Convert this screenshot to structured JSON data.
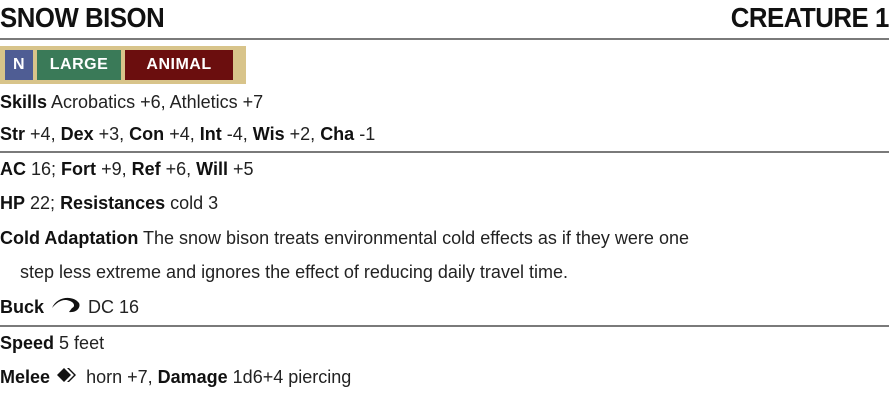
{
  "creature": {
    "name": "SNOW BISON",
    "level": "CREATURE 1"
  },
  "traits": [
    {
      "label": "N",
      "color": "#4f5d94"
    },
    {
      "label": "LARGE",
      "color": "#3a7a58"
    },
    {
      "label": "ANIMAL",
      "color": "#6b0e0e"
    }
  ],
  "skills": {
    "label": "Skills",
    "text": "Acrobatics +6, Athletics +7"
  },
  "abilities": [
    {
      "label": "Str",
      "value": "+4",
      "sep": ", "
    },
    {
      "label": "Dex",
      "value": "+3",
      "sep": ", "
    },
    {
      "label": "Con",
      "value": "+4",
      "sep": ", "
    },
    {
      "label": "Int",
      "value": "-4",
      "sep": ", "
    },
    {
      "label": "Wis",
      "value": "+2",
      "sep": ", "
    },
    {
      "label": "Cha",
      "value": "-1",
      "sep": ""
    }
  ],
  "defense": {
    "ac_label": "AC",
    "ac_value": "16; ",
    "fort_label": "Fort",
    "fort_value": "+9, ",
    "ref_label": "Ref",
    "ref_value": "+6, ",
    "will_label": "Will",
    "will_value": "+5"
  },
  "hp": {
    "label": "HP",
    "value": "22; ",
    "res_label": "Resistances",
    "res_value": "cold 3"
  },
  "cold_adaptation": {
    "label": "Cold Adaptation",
    "line1": "The snow bison treats environmental cold effects as if they were one",
    "line2": "step less extreme and ignores the effect of reducing daily travel time."
  },
  "buck": {
    "label": "Buck",
    "icon": "reaction-icon",
    "text": "DC 16"
  },
  "speed": {
    "label": "Speed",
    "text": "5 feet"
  },
  "melee": {
    "label": "Melee",
    "icon": "single-action-icon",
    "attack": "horn +7, ",
    "damage_label": "Damage",
    "damage_value": "1d6+4 piercing"
  }
}
